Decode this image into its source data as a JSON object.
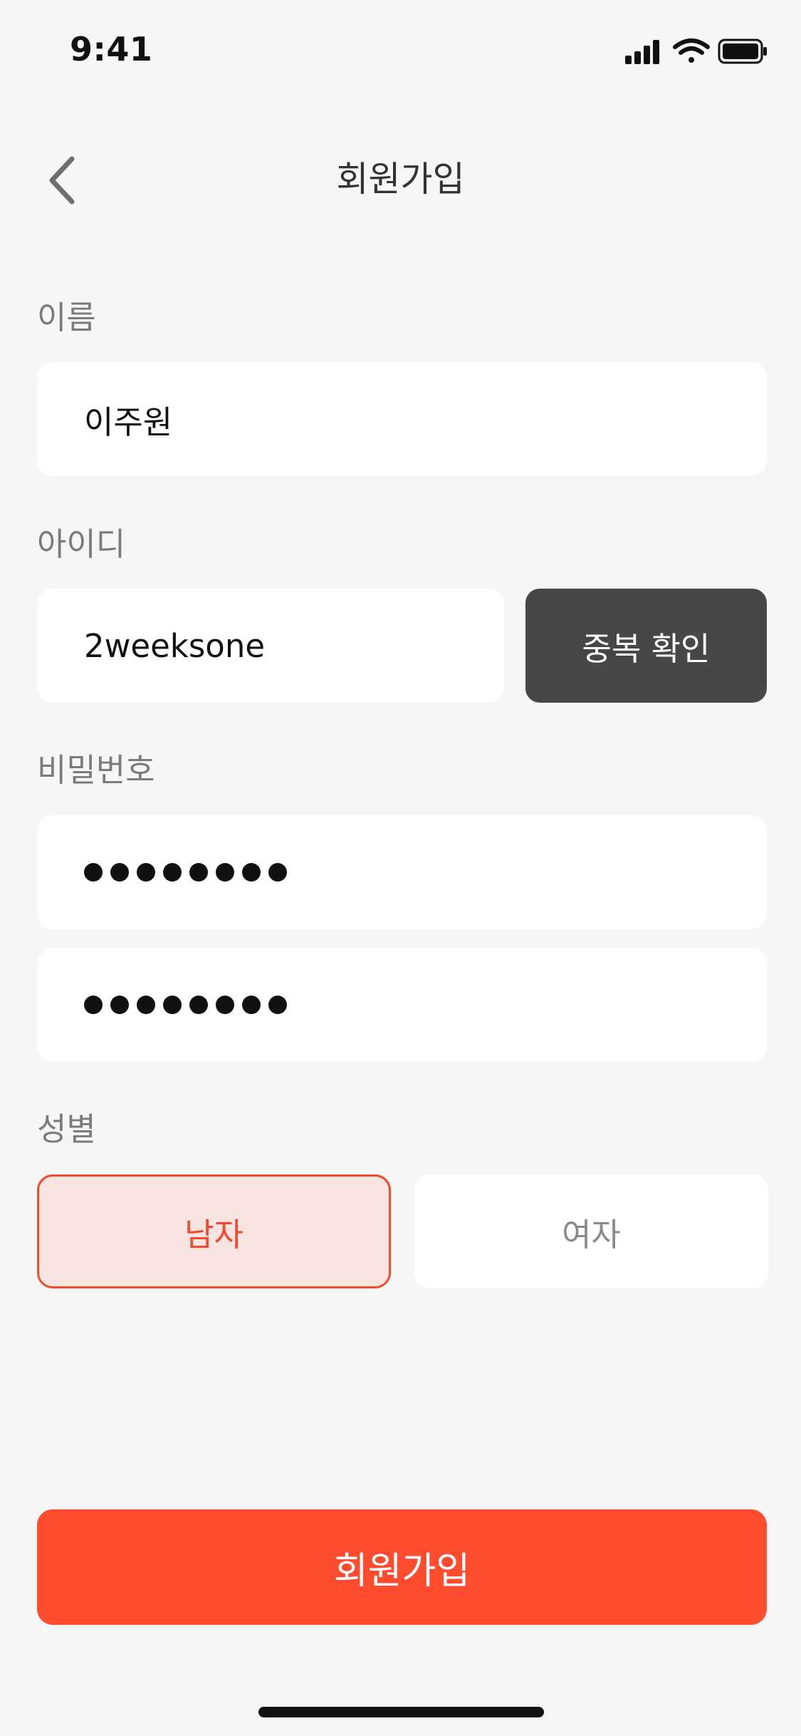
{
  "status_bar": {
    "time": "9:41",
    "icons": [
      "cellular-signal-icon",
      "wifi-icon",
      "battery-icon"
    ]
  },
  "header": {
    "title": "회원가입",
    "back_icon": "chevron-left-icon"
  },
  "form": {
    "name": {
      "label": "이름",
      "value": "이주원"
    },
    "user_id": {
      "label": "아이디",
      "value": "2weeksone",
      "check_button_label": "중복 확인"
    },
    "password": {
      "label": "비밀번호",
      "masked_length": 8,
      "confirm_masked_length": 8
    },
    "gender": {
      "label": "성별",
      "options": [
        "남자",
        "여자"
      ],
      "selected": "남자"
    },
    "submit_label": "회원가입"
  },
  "colors": {
    "accent": "#ff4c2f",
    "selected_border": "#f24a30",
    "selected_bg": "#f8e5e2",
    "dark_button": "#474747",
    "background": "#f6f6f6"
  }
}
